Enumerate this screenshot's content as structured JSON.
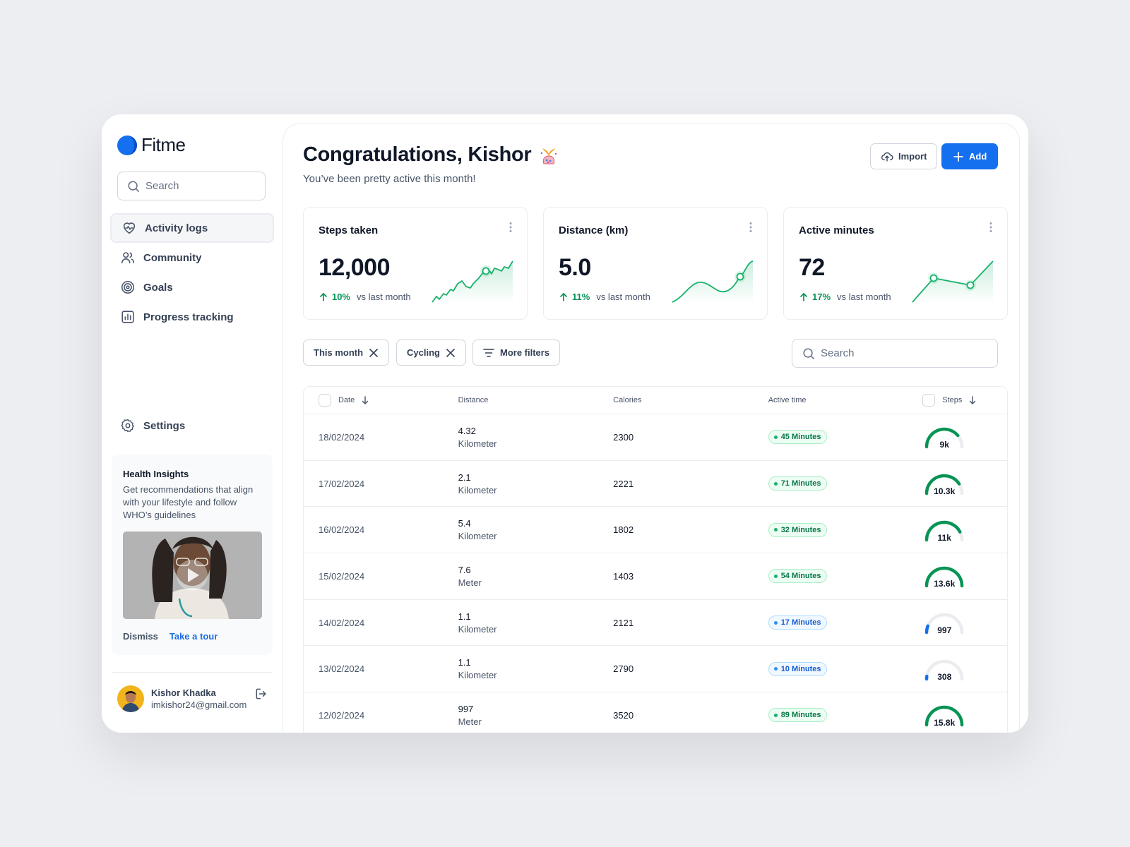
{
  "app": {
    "name": "Fitme"
  },
  "sidebar": {
    "search_placeholder": "Search",
    "items": [
      {
        "label": "Activity logs",
        "icon": "heart-pulse-icon",
        "active": true
      },
      {
        "label": "Community",
        "icon": "users-icon",
        "active": false
      },
      {
        "label": "Goals",
        "icon": "target-icon",
        "active": false
      },
      {
        "label": "Progress tracking",
        "icon": "bar-chart-icon",
        "active": false
      }
    ],
    "settings_label": "Settings",
    "insights": {
      "title": "Health Insights",
      "text": "Get recommendations that align with your lifestyle and follow WHO’s guidelines",
      "dismiss": "Dismiss",
      "tour": "Take a tour"
    },
    "user": {
      "name": "Kishor Khadka",
      "email": "imkishor24@gmail.com"
    }
  },
  "header": {
    "title": "Congratulations, Kishor",
    "subtitle": "You’ve been pretty active this month!",
    "import_label": "Import",
    "add_label": "Add"
  },
  "cards": [
    {
      "title": "Steps taken",
      "value": "12,000",
      "delta": "10%",
      "delta_note": "vs last month"
    },
    {
      "title": "Distance (km)",
      "value": "5.0",
      "delta": "11%",
      "delta_note": "vs last month"
    },
    {
      "title": "Active minutes",
      "value": "72",
      "delta": "17%",
      "delta_note": "vs last month"
    }
  ],
  "filters": {
    "chips": [
      "This month",
      "Cycling"
    ],
    "more_label": "More filters",
    "search_placeholder": "Search"
  },
  "table": {
    "headers": {
      "date": "Date",
      "distance": "Distance",
      "calories": "Calories",
      "active_time": "Active time",
      "steps": "Steps"
    },
    "rows": [
      {
        "date": "18/02/2024",
        "distance": "4.32",
        "unit": "Kilometer",
        "calories": "2300",
        "active": "45 Minutes",
        "status": "green",
        "steps": "9k",
        "steps_fill": 0.78
      },
      {
        "date": "17/02/2024",
        "distance": "2.1",
        "unit": "Kilometer",
        "calories": "2221",
        "active": "71 Minutes",
        "status": "green",
        "steps": "10.3k",
        "steps_fill": 0.82
      },
      {
        "date": "16/02/2024",
        "distance": "5.4",
        "unit": "Kilometer",
        "calories": "1802",
        "active": "32 Minutes",
        "status": "green",
        "steps": "11k",
        "steps_fill": 0.85
      },
      {
        "date": "15/02/2024",
        "distance": "7.6",
        "unit": "Meter",
        "calories": "1403",
        "active": "54 Minutes",
        "status": "green",
        "steps": "13.6k",
        "steps_fill": 1.0
      },
      {
        "date": "14/02/2024",
        "distance": "1.1",
        "unit": "Kilometer",
        "calories": "2121",
        "active": "17 Minutes",
        "status": "blue",
        "steps": "997",
        "steps_fill": 0.12
      },
      {
        "date": "13/02/2024",
        "distance": "1.1",
        "unit": "Kilometer",
        "calories": "2790",
        "active": "10 Minutes",
        "status": "blue",
        "steps": "308",
        "steps_fill": 0.05
      },
      {
        "date": "12/02/2024",
        "distance": "997",
        "unit": "Meter",
        "calories": "3520",
        "active": "89 Minutes",
        "status": "green",
        "steps": "15.8k",
        "steps_fill": 1.0
      }
    ]
  },
  "colors": {
    "accent": "#1570ef",
    "success": "#079455",
    "link": "#1d6ce0"
  }
}
